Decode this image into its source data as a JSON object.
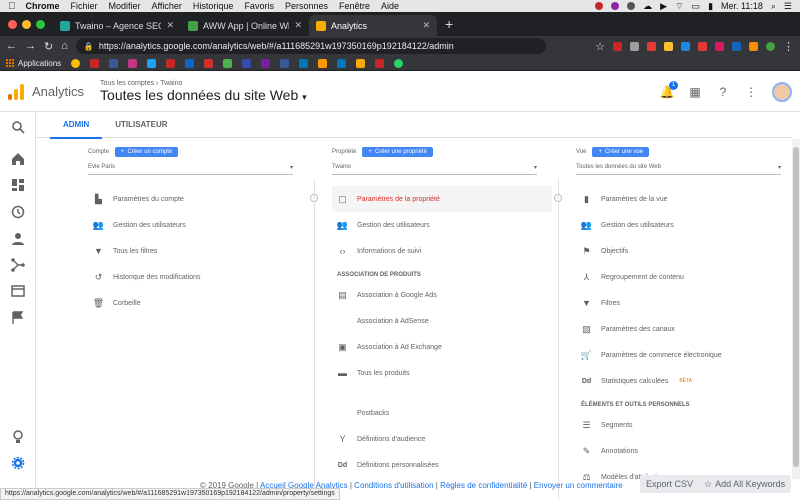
{
  "mac": {
    "app": "Chrome",
    "menus": [
      "Fichier",
      "Modifier",
      "Afficher",
      "Historique",
      "Favoris",
      "Personnes",
      "Fenêtre",
      "Aide"
    ],
    "clock": "Mer. 11:18"
  },
  "tabs": [
    {
      "title": "Twaino – Agence SEO",
      "color": "#26a69a"
    },
    {
      "title": "AWW App | Online Whiteboard",
      "color": "#43a047"
    },
    {
      "title": "Analytics",
      "color": "#f9ab00"
    }
  ],
  "browser": {
    "url": "https://analytics.google.com/analytics/web/#/a111685291w197350169p192184122/admin"
  },
  "bookmarks": {
    "apps_label": "Applications",
    "icon_colors": [
      "#fbbc05",
      "#c62828",
      "#3b5998",
      "#c13584",
      "#1da1f2",
      "#c62828",
      "#0a66c2",
      "#d32f2f",
      "#4caf50",
      "#3949ab",
      "#7b1fa2",
      "#3b5998",
      "#0077b5",
      "#ff9800",
      "#0277bd",
      "#f9ab00",
      "#c62828",
      "#25d366"
    ]
  },
  "ga": {
    "product": "Analytics",
    "breadcrumb_small": "Tous les comptes › Twaino",
    "view_title": "Toutes les données du site Web",
    "notification_count": "1"
  },
  "admin_tabs": [
    "ADMIN",
    "UTILISATEUR"
  ],
  "account": {
    "label": "Compte",
    "create": "Créer un compte",
    "selected": "Evle Paris",
    "items": [
      {
        "label": "Paramètres du compte",
        "icon": "building-icon"
      },
      {
        "label": "Gestion des utilisateurs",
        "icon": "people-icon"
      },
      {
        "label": "Tous les filtres",
        "icon": "filter-icon"
      },
      {
        "label": "Historique des modifications",
        "icon": "history-icon"
      },
      {
        "label": "Corbeille",
        "icon": "trash-icon"
      }
    ]
  },
  "property": {
    "label": "Propriété",
    "create": "Créer une propriété",
    "selected": "Twaino",
    "items": [
      {
        "label": "Paramètres de la propriété",
        "icon": "settings-box-icon"
      },
      {
        "label": "Gestion des utilisateurs",
        "icon": "people-icon"
      },
      {
        "label": "Informations de suivi",
        "icon": "code-icon"
      }
    ],
    "section": "ASSOCIATION DE PRODUITS",
    "products": [
      {
        "label": "Association à Google Ads",
        "icon": "ads-icon"
      },
      {
        "label": "Association à AdSense",
        "icon": "adsense-icon"
      },
      {
        "label": "Association à Ad Exchange",
        "icon": "adexchange-icon"
      },
      {
        "label": "Tous les produits",
        "icon": "products-icon"
      }
    ],
    "more": [
      {
        "label": "Postbacks",
        "icon": "postbacks-icon"
      },
      {
        "label": "Définitions d'audience",
        "icon": "audience-icon"
      },
      {
        "label": "Définitions personnalisées",
        "icon": "dd-icon"
      }
    ]
  },
  "view": {
    "label": "Vue",
    "create": "Créer une vue",
    "selected": "Toutes les données du site Web",
    "items": [
      {
        "label": "Paramètres de la vue",
        "icon": "doc-icon"
      },
      {
        "label": "Gestion des utilisateurs",
        "icon": "people-icon"
      },
      {
        "label": "Objectifs",
        "icon": "flag-icon"
      },
      {
        "label": "Regroupement de contenu",
        "icon": "group-icon"
      },
      {
        "label": "Filtres",
        "icon": "filter-icon"
      },
      {
        "label": "Paramètres des canaux",
        "icon": "channels-icon"
      },
      {
        "label": "Paramètres de commerce électronique",
        "icon": "cart-icon"
      },
      {
        "label": "Statistiques calculées",
        "icon": "dd-icon"
      }
    ],
    "beta": "BÊTA",
    "section": "ÉLÉMENTS ET OUTILS PERSONNELS",
    "tools": [
      {
        "label": "Segments",
        "icon": "segments-icon"
      },
      {
        "label": "Annotations",
        "icon": "annotations-icon"
      },
      {
        "label": "Modèles d'attribution",
        "icon": "attribution-icon"
      }
    ]
  },
  "footer": {
    "copyright": "© 2019 Google |",
    "links": [
      "Accueil Google Analytics",
      "Conditions d'utilisation",
      "Règles de confidentialité",
      "Envoyer un commentaire"
    ],
    "sep": "|"
  },
  "status_url": "https://analytics.google.com/analytics/web/#/a111685291w197350169p192184122/admin/property/settings",
  "floating": {
    "export": "Export CSV",
    "keywords": "Add All Keywords"
  }
}
